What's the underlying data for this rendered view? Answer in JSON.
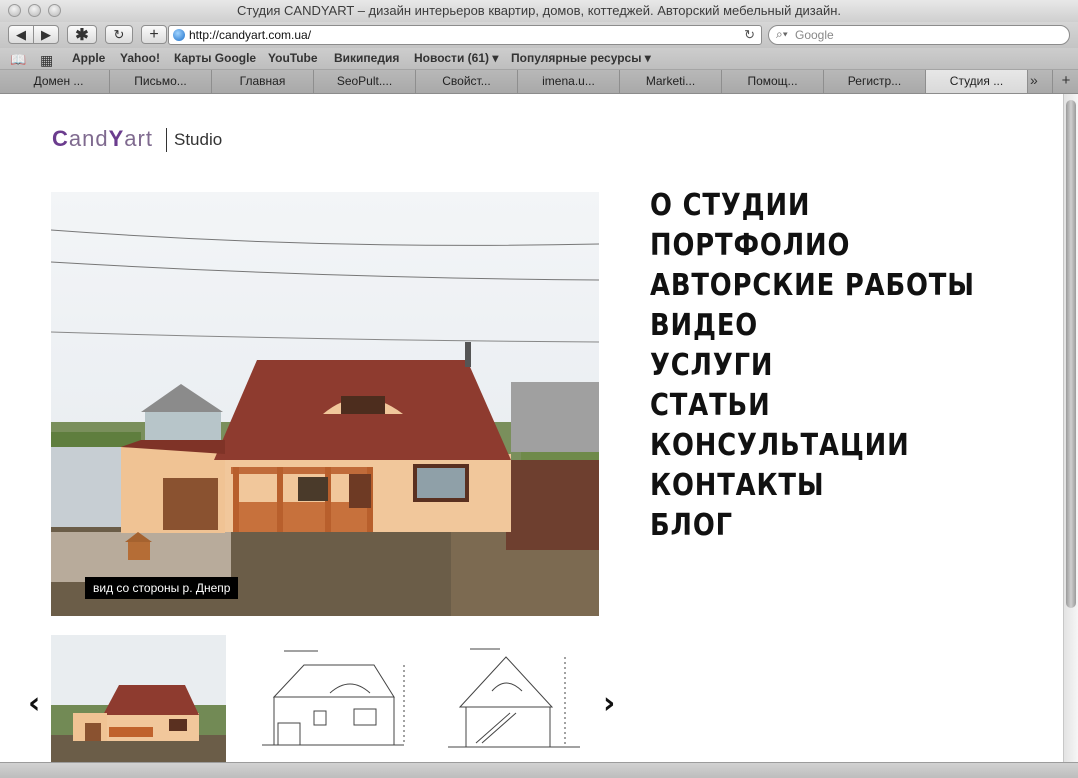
{
  "window": {
    "title": "Студия CANDYART – дизайн интерьеров квартир, домов, коттеджей. Авторский мебельный дизайн."
  },
  "toolbar": {
    "url": "http://candyart.com.ua/",
    "search_placeholder": "Google"
  },
  "bookmarks": [
    "Apple",
    "Yahoo!",
    "Карты Google",
    "YouTube",
    "Википедия",
    "Новости (61) ▾",
    "Популярные ресурсы ▾"
  ],
  "tabs": [
    "Домен ...",
    "Письмо...",
    "Главная",
    "SeoPult....",
    "Свойст...",
    "imena.u...",
    "Marketi...",
    "Помощ...",
    "Регистр...",
    "Студия ..."
  ],
  "logo": {
    "c": "C",
    "and": "and",
    "y": "Y",
    "art": "art",
    "studio": "Studio"
  },
  "slideshow": {
    "caption": "вид со стороны р. Днепр"
  },
  "menu": [
    "О СТУДИИ",
    "ПОРТФОЛИО",
    "АВТОРСКИЕ РАБОТЫ",
    "ВИДЕО",
    "УСЛУГИ",
    "СТАТЬИ",
    "КОНСУЛЬТАЦИИ",
    "КОНТАКТЫ",
    "БЛОГ"
  ],
  "thumbs": {
    "prev": "‹",
    "next": "›"
  },
  "colors": {
    "logo_accent": "#6b3c8e",
    "roof": "#8e3b2f",
    "wall": "#f1c79b"
  }
}
